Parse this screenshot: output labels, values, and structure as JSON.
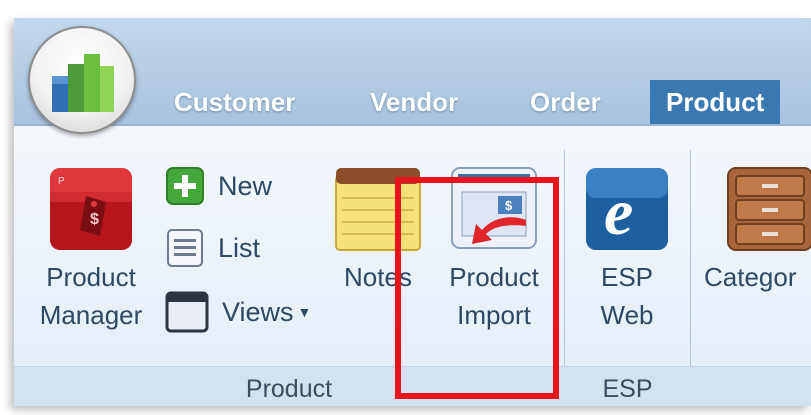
{
  "tabs": [
    {
      "label": "Customer",
      "active": false
    },
    {
      "label": "Vendor",
      "active": false
    },
    {
      "label": "Order",
      "active": false
    },
    {
      "label": "Product",
      "active": true
    }
  ],
  "ribbon": {
    "product_group": {
      "label": "Product",
      "product_manager": {
        "line1": "Product",
        "line2": "Manager",
        "icon": "product-manager-icon"
      },
      "new": {
        "label": "New",
        "icon": "plus-icon"
      },
      "list": {
        "label": "List",
        "icon": "list-icon"
      },
      "views": {
        "label": "Views",
        "icon": "window-icon"
      },
      "notes": {
        "label": "Notes",
        "icon": "notepad-icon"
      },
      "product_import": {
        "line1": "Product",
        "line2": "Import",
        "icon": "import-icon"
      }
    },
    "esp_group": {
      "label": "ESP",
      "esp_web": {
        "line1": "ESP",
        "line2": "Web",
        "icon": "esp-e-icon"
      }
    },
    "categories": {
      "label": "Categor",
      "icon": "cabinet-icon"
    }
  },
  "colors": {
    "tab_active": "#3a78b2",
    "highlight": "#e8141b",
    "label_text": "#2e4865"
  }
}
